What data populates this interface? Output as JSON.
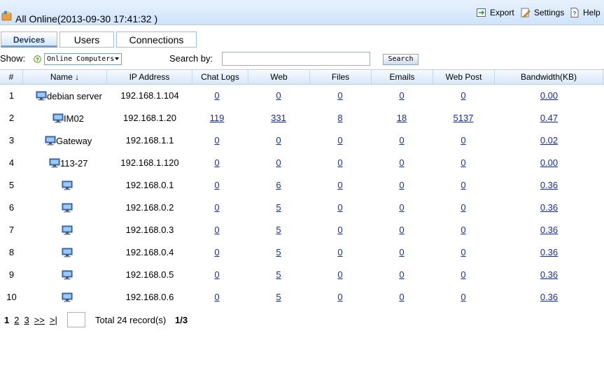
{
  "header": {
    "title": "All Online(2013-09-30 17:41:32 )",
    "export_label": "Export",
    "settings_label": "Settings",
    "help_label": "Help"
  },
  "tabs": [
    {
      "label": "Devices",
      "active": true
    },
    {
      "label": "Users",
      "active": false
    },
    {
      "label": "Connections",
      "active": false
    }
  ],
  "filter": {
    "show_label": "Show:",
    "show_value": "Online Computers",
    "search_by_label": "Search by:",
    "search_value": "",
    "search_button": "Search"
  },
  "table": {
    "columns": [
      "#",
      "Name ↓",
      "IP Address",
      "Chat Logs",
      "Web",
      "Files",
      "Emails",
      "Web Post",
      "Bandwidth(KB)"
    ],
    "rows": [
      {
        "num": "1",
        "name": "debian server",
        "ip": "192.168.1.104",
        "chat": "0",
        "web": "0",
        "files": "0",
        "emails": "0",
        "webpost": "0",
        "bw": "0.00"
      },
      {
        "num": "2",
        "name": "IM02",
        "ip": "192.168.1.20",
        "chat": "119",
        "web": "331",
        "files": "8",
        "emails": "18",
        "webpost": "5137",
        "bw": "0.47"
      },
      {
        "num": "3",
        "name": "Gateway",
        "ip": "192.168.1.1",
        "chat": "0",
        "web": "0",
        "files": "0",
        "emails": "0",
        "webpost": "0",
        "bw": "0.02"
      },
      {
        "num": "4",
        "name": "113-27",
        "ip": "192.168.1.120",
        "chat": "0",
        "web": "0",
        "files": "0",
        "emails": "0",
        "webpost": "0",
        "bw": "0.00"
      },
      {
        "num": "5",
        "name": "",
        "ip": "192.168.0.1",
        "chat": "0",
        "web": "6",
        "files": "0",
        "emails": "0",
        "webpost": "0",
        "bw": "0.36"
      },
      {
        "num": "6",
        "name": "",
        "ip": "192.168.0.2",
        "chat": "0",
        "web": "5",
        "files": "0",
        "emails": "0",
        "webpost": "0",
        "bw": "0.36"
      },
      {
        "num": "7",
        "name": "",
        "ip": "192.168.0.3",
        "chat": "0",
        "web": "5",
        "files": "0",
        "emails": "0",
        "webpost": "0",
        "bw": "0.36"
      },
      {
        "num": "8",
        "name": "",
        "ip": "192.168.0.4",
        "chat": "0",
        "web": "5",
        "files": "0",
        "emails": "0",
        "webpost": "0",
        "bw": "0.36"
      },
      {
        "num": "9",
        "name": "",
        "ip": "192.168.0.5",
        "chat": "0",
        "web": "5",
        "files": "0",
        "emails": "0",
        "webpost": "0",
        "bw": "0.36"
      },
      {
        "num": "10",
        "name": "",
        "ip": "192.168.0.6",
        "chat": "0",
        "web": "5",
        "files": "0",
        "emails": "0",
        "webpost": "0",
        "bw": "0.36"
      }
    ]
  },
  "pager": {
    "pages": [
      "1",
      "2",
      "3",
      ">>",
      ">|"
    ],
    "current": "1",
    "total_text": "Total 24 record(s)",
    "page_position": "1/3"
  },
  "icons": {
    "app": "people-folder-icon",
    "export": "export-icon",
    "settings": "settings-pencil-icon",
    "help": "help-document-icon",
    "device": "computer-monitor-icon"
  },
  "colors": {
    "link": "#1c2f8f",
    "header_gradient_top": "#e8f2fd",
    "header_gradient_bottom": "#cfe3fa",
    "active_tab_text": "#1a3e73"
  }
}
